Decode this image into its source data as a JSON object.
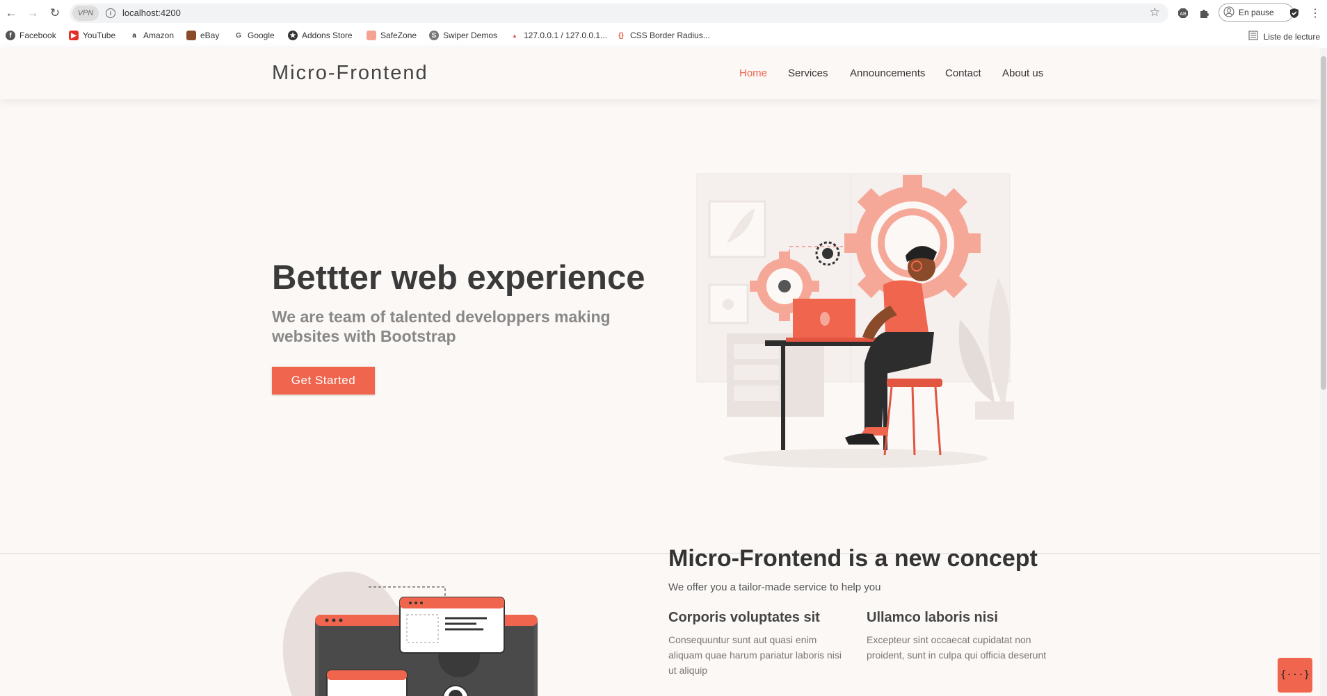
{
  "browser": {
    "url": "localhost:4200",
    "vpn_label": "VPN",
    "profile_label": "En pause",
    "reading_list_label": "Liste de lecture",
    "bookmarks": [
      {
        "label": "Facebook",
        "icon": "facebook-icon",
        "color": "#555555"
      },
      {
        "label": "YouTube",
        "icon": "youtube-icon",
        "color": "#e52d27"
      },
      {
        "label": "Amazon",
        "icon": "amazon-icon",
        "color": "#222222"
      },
      {
        "label": "eBay",
        "icon": "ebay-icon",
        "color": "#333333"
      },
      {
        "label": "Google",
        "icon": "google-icon",
        "color": "#444444"
      },
      {
        "label": "Addons Store",
        "icon": "addons-icon",
        "color": "#333333"
      },
      {
        "label": "SafeZone",
        "icon": "safezone-icon",
        "color": "#f0654e"
      },
      {
        "label": "Swiper Demos",
        "icon": "swiper-icon",
        "color": "#666666"
      },
      {
        "label": "127.0.0.1 / 127.0.0.1...",
        "icon": "phpmyadmin-icon",
        "color": "#d9534f"
      },
      {
        "label": "CSS Border Radius...",
        "icon": "css-icon",
        "color": "#e0553c"
      }
    ]
  },
  "site": {
    "logo": "Micro-Frontend",
    "nav": [
      "Home",
      "Services",
      "Announcements",
      "Contact",
      "About us"
    ],
    "accent": "#f0654e"
  },
  "hero": {
    "title": "Bettter web experience",
    "subtitle": "We are team of talented developpers making websites with Bootstrap",
    "cta": "Get Started"
  },
  "about": {
    "title": "Micro-Frontend is a new concept",
    "lead": "We offer you a tailor-made service to help you",
    "features": [
      {
        "title": "Corporis voluptates sit",
        "text": "Consequuntur sunt aut quasi enim aliquam quae harum pariatur laboris nisi ut aliquip"
      },
      {
        "title": "Ullamco laboris nisi",
        "text": "Excepteur sint occaecat cupidatat non proident, sunt in culpa qui officia deserunt"
      }
    ]
  },
  "floating_button": "{···}"
}
